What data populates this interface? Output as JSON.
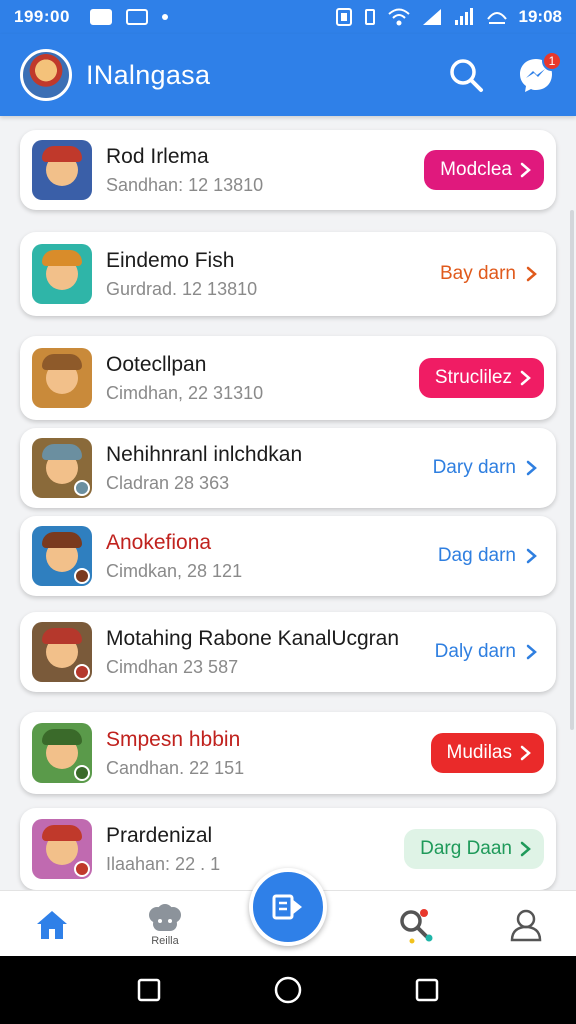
{
  "status_bar": {
    "time_left": "199:00",
    "time_right": "19:08"
  },
  "header": {
    "title": "INalngasa",
    "notification_count": "1"
  },
  "games": [
    {
      "title": "Rod Irlema",
      "subtitle": "Sandhan: 12 13810",
      "action": "Modclea",
      "style": "pill",
      "color": "#e0197d",
      "thumb_bg": "#3a5fa8",
      "hat": "#c0392b"
    },
    {
      "title": "Eindemo Fish",
      "subtitle": "Gurdrad. 12 13810",
      "action": "Bay darn",
      "style": "link",
      "color": "#e05a1c",
      "thumb_bg": "#2fb5a8",
      "hat": "#d98c2a"
    },
    {
      "title": "Ootecllpan",
      "subtitle": "Cimdhan, 22 31310",
      "action": "Struclilez",
      "style": "pill",
      "color": "#f01c64",
      "thumb_bg": "#c98a3a",
      "hat": "#8e5a2a"
    },
    {
      "title": "Nehihnranl inlchdkan",
      "subtitle": "Cladran 28 363",
      "action": "Dary darn",
      "style": "link",
      "color": "#2f7fe0",
      "thumb_bg": "#8a6a3a",
      "hat": "#6b8fa0"
    },
    {
      "title": "Anokefiona",
      "subtitle": "Cimdkan, 28 121",
      "action": "Dag darn",
      "style": "link",
      "color": "#2f7fe0",
      "thumb_bg": "#2f7fbf",
      "hat": "#7a3a1e"
    },
    {
      "title": "Motahing Rabone KanalUcgran",
      "subtitle": "Cimdhan 23 587",
      "action": "Daly darn",
      "style": "link",
      "color": "#2f7fe0",
      "thumb_bg": "#7a5a3a",
      "hat": "#b5382c"
    },
    {
      "title": "Smpesn hbbin",
      "subtitle": "Candhan. 22 151",
      "action": "Mudilas",
      "style": "pill",
      "color": "#ea2a2a",
      "thumb_bg": "#5a9a4a",
      "hat": "#3a6a2a"
    },
    {
      "title": "Prardenizal",
      "subtitle": "Ilaahan: 22 . 1",
      "action": "Darg Daan",
      "style": "soft",
      "color": "#1f9a5a",
      "thumb_bg": "#c06ab0",
      "hat": "#c0392b"
    }
  ],
  "title_accents": {
    "4": "#c0221e",
    "6": "#c0221e"
  },
  "bottom_nav": {
    "home_icon": "home-icon",
    "games_label": "Reilla",
    "fab_icon": "edit-icon",
    "search_icon": "search-icon",
    "profile_icon": "person-icon"
  },
  "colors": {
    "brand": "#2f80e8"
  }
}
